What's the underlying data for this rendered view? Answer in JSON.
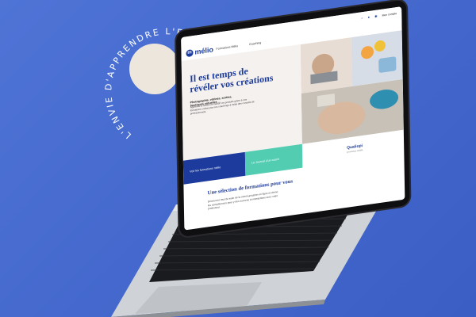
{
  "background": {
    "color": "#4a6dd2",
    "circle_color": "#ece6dd"
  },
  "arc_text": "L'ENVIE D'APPRENDRE L'ENVIE D'APPRENDRE",
  "site": {
    "logo": "mélio",
    "nav": [
      "Formations Mélio",
      "Coaching"
    ],
    "account_label": "Mon compte",
    "hero_title_line1": "Il est temps de",
    "hero_title_line2": "révéler vos créations",
    "hero_lead": "Photographie, vitrines, sorties, boutiques virtuelles ...",
    "hero_body": "Apprenez à mettre en valeur vos produits grâce à nos formations créées par nos coachings à l'aide des conseils de professionnels.",
    "btn_primary": "Voir les formations mélio",
    "btn_secondary": "Le Journal d'un coach",
    "qualiopi": "Qualiopi",
    "qualiopi_sub": "processus certifié",
    "section_title": "Une sélection de formations pour vous",
    "section_body": "Découvrez tout de suite de la communication en ligne et vitrine les compétences pour y des success et interactions avec votre professeur",
    "brand_color": "#1c3b9c",
    "accent_green": "#53cdb1"
  }
}
